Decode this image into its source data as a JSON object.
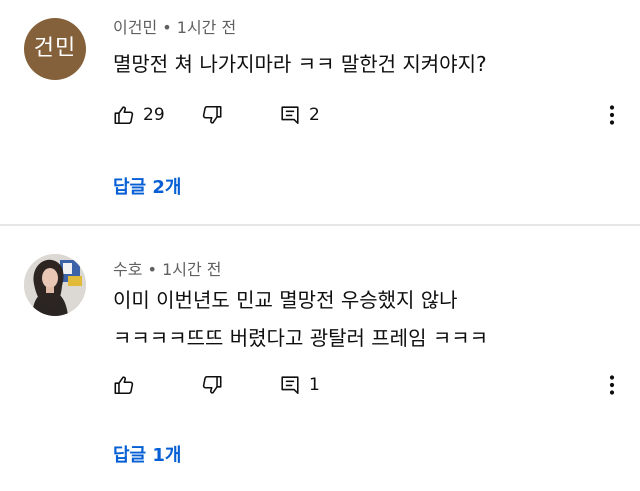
{
  "comments": [
    {
      "author": "이건민",
      "time": "1시간 전",
      "avatar_text": "건민",
      "text_lines": [
        "멸망전 쳐 나가지마라 ㅋㅋ 말한건 지켜야지?"
      ],
      "likes": "29",
      "reply_count": "2",
      "replies_label": "답글 2개"
    },
    {
      "author": "수호",
      "time": "1시간 전",
      "avatar_text": "",
      "text_lines": [
        "이미 이번년도 민교 멸망전 우승했지 않나",
        "ㅋㅋㅋㅋ뜨뜨 버렸다고 광탈러 프레임 ㅋㅋㅋ"
      ],
      "likes": "",
      "reply_count": "1",
      "replies_label": "답글 1개"
    }
  ],
  "separator": " • ",
  "icons": {
    "like": "thumbs-up-icon",
    "dislike": "thumbs-down-icon",
    "reply": "comment-icon",
    "more": "more-vert-icon"
  },
  "colors": {
    "link": "#065fd4",
    "meta": "#606060",
    "avatar_1": "#84613a"
  }
}
